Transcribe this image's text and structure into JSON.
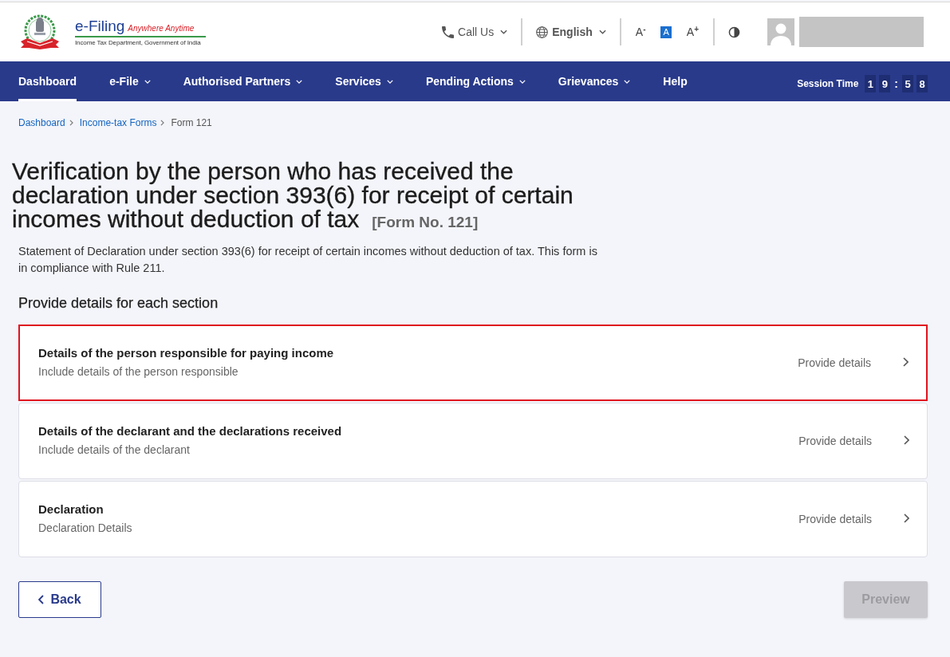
{
  "header": {
    "logo": {
      "title": "e-Filing",
      "tagline": "Anywhere Anytime",
      "subtitle": "Income Tax Department, Government of India"
    },
    "call_us": {
      "label": "Call Us"
    },
    "language": {
      "label": "English"
    },
    "font_size_controls": [
      {
        "label": "A",
        "sign": "-",
        "selected": false
      },
      {
        "label": "A",
        "selected": true
      },
      {
        "label": "A",
        "sign": "+",
        "selected": false
      }
    ]
  },
  "nav": {
    "items": [
      {
        "label": "Dashboard",
        "selected": true,
        "has_menu": false
      },
      {
        "label": "e-File",
        "selected": false,
        "has_menu": true
      },
      {
        "label": "Authorised Partners",
        "selected": false,
        "has_menu": true
      },
      {
        "label": "Services",
        "selected": false,
        "has_menu": true
      },
      {
        "label": "Pending Actions",
        "selected": false,
        "has_menu": true
      },
      {
        "label": "Grievances",
        "selected": false,
        "has_menu": true
      },
      {
        "label": "Help",
        "selected": false,
        "has_menu": false
      }
    ],
    "session_time": {
      "label": "Session Time",
      "minutes": [
        "1",
        "9"
      ],
      "separator": ":",
      "seconds": [
        "5",
        "8"
      ]
    }
  },
  "breadcrumb": [
    {
      "label": "Dashboard",
      "kind": "link"
    },
    {
      "label": "Income-tax Forms",
      "kind": "link"
    },
    {
      "label": "Form 121",
      "kind": "current"
    }
  ],
  "page": {
    "title": "Verification by the person who has received the declaration under section 393(6) for receipt of certain incomes without deduction of tax",
    "form_number": "[Form No. 121]",
    "description": "Statement of Declaration under section 393(6) for receipt of certain incomes without deduction of tax. This form is in compliance with Rule 211.",
    "section_heading": "Provide details for each section"
  },
  "sections": [
    {
      "title": "Details of the person responsible for paying income",
      "subtitle": "Include details of the person responsible",
      "action": "Provide details",
      "highlighted": true
    },
    {
      "title": "Details of the declarant and the declarations received",
      "subtitle": "Include details of the declarant",
      "action": "Provide details",
      "highlighted": false
    },
    {
      "title": "Declaration",
      "subtitle": "Declaration Details",
      "action": "Provide details",
      "highlighted": false
    }
  ],
  "buttons": [
    {
      "kind": "back",
      "label": "Back",
      "disabled": false
    },
    {
      "kind": "preview",
      "label": "Preview",
      "disabled": true
    }
  ]
}
